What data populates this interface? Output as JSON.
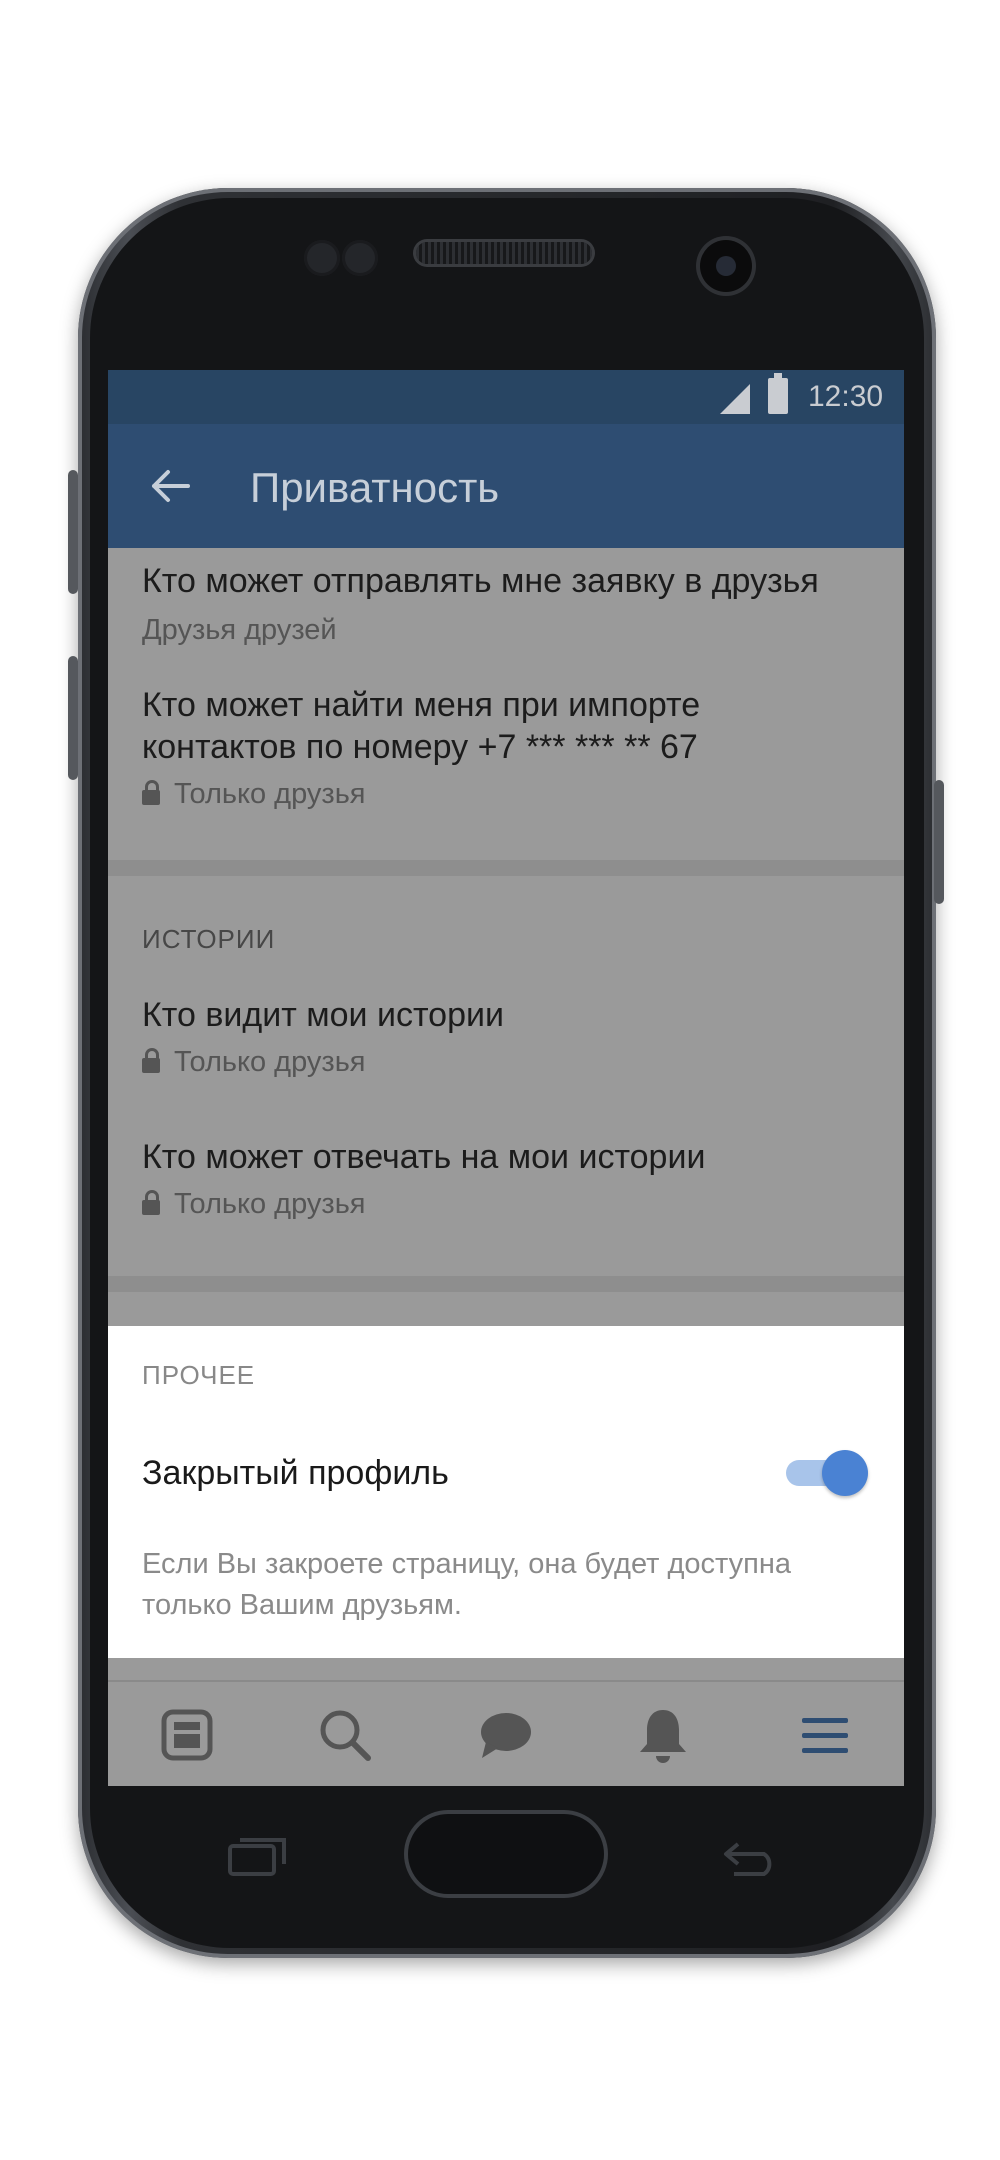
{
  "statusbar": {
    "time": "12:30",
    "icons": [
      "cell-signal-icon",
      "battery-icon"
    ]
  },
  "toolbar": {
    "title": "Приватность",
    "back_icon": "arrow-left-icon"
  },
  "settings": [
    {
      "title": "Кто может отправлять мне заявку в друзья",
      "value": "Друзья друзей",
      "locked": false
    },
    {
      "title_lines": [
        "Кто может найти меня при импорте",
        "контактов по номеру +7 *** *** ** 67"
      ],
      "value": "Только друзья",
      "locked": true
    }
  ],
  "stories": {
    "header": "ИСТОРИИ",
    "items": [
      {
        "title": "Кто видит мои истории",
        "value": "Только друзья",
        "locked": true
      },
      {
        "title": "Кто может отвечать на мои истории",
        "value": "Только друзья",
        "locked": true
      }
    ]
  },
  "other": {
    "header": "ПРОЧЕЕ",
    "closed_profile": {
      "label": "Закрытый профиль",
      "enabled": true
    },
    "hint": "Если Вы закроете страницу, она будет доступна только Вашим друзьям."
  },
  "bottom_nav": {
    "items": [
      {
        "name": "news",
        "icon": "news-feed-icon"
      },
      {
        "name": "search",
        "icon": "search-icon"
      },
      {
        "name": "messages",
        "icon": "chat-bubble-icon"
      },
      {
        "name": "notifications",
        "icon": "bell-icon"
      },
      {
        "name": "menu",
        "icon": "menu-icon",
        "active": true
      }
    ]
  },
  "colors": {
    "accent": "#4a82d3",
    "toolbar": "#2e4d72",
    "statusbar": "#284563"
  }
}
